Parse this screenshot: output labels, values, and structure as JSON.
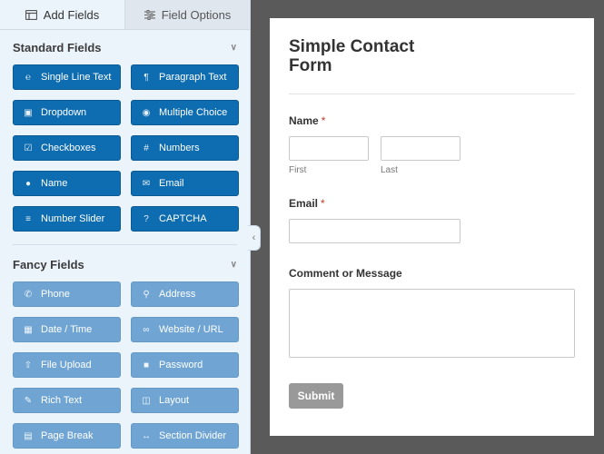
{
  "tabs": [
    {
      "label": "Add Fields",
      "icon": "grid-icon",
      "active": true
    },
    {
      "label": "Field Options",
      "icon": "sliders-icon",
      "active": false
    }
  ],
  "standard": {
    "title": "Standard Fields",
    "fields": [
      {
        "label": "Single Line Text",
        "icon": "text-cursor-icon"
      },
      {
        "label": "Paragraph Text",
        "icon": "paragraph-icon"
      },
      {
        "label": "Dropdown",
        "icon": "dropdown-icon"
      },
      {
        "label": "Multiple Choice",
        "icon": "radio-icon"
      },
      {
        "label": "Checkboxes",
        "icon": "checkbox-icon"
      },
      {
        "label": "Numbers",
        "icon": "hash-icon"
      },
      {
        "label": "Name",
        "icon": "user-icon"
      },
      {
        "label": "Email",
        "icon": "envelope-icon"
      },
      {
        "label": "Number Slider",
        "icon": "slider-icon"
      },
      {
        "label": "CAPTCHA",
        "icon": "question-circle-icon"
      }
    ]
  },
  "fancy": {
    "title": "Fancy Fields",
    "fields": [
      {
        "label": "Phone",
        "icon": "phone-icon"
      },
      {
        "label": "Address",
        "icon": "map-pin-icon"
      },
      {
        "label": "Date / Time",
        "icon": "calendar-icon"
      },
      {
        "label": "Website / URL",
        "icon": "link-icon"
      },
      {
        "label": "File Upload",
        "icon": "upload-icon"
      },
      {
        "label": "Password",
        "icon": "lock-icon"
      },
      {
        "label": "Rich Text",
        "icon": "edit-icon"
      },
      {
        "label": "Layout",
        "icon": "columns-icon"
      },
      {
        "label": "Page Break",
        "icon": "file-icon"
      },
      {
        "label": "Section Divider",
        "icon": "arrows-h-icon"
      }
    ]
  },
  "form": {
    "title": "Simple Contact Form",
    "name_label": "Name",
    "required_marker": "*",
    "first_sub": "First",
    "last_sub": "Last",
    "email_label": "Email",
    "comment_label": "Comment or Message",
    "submit_label": "Submit"
  }
}
